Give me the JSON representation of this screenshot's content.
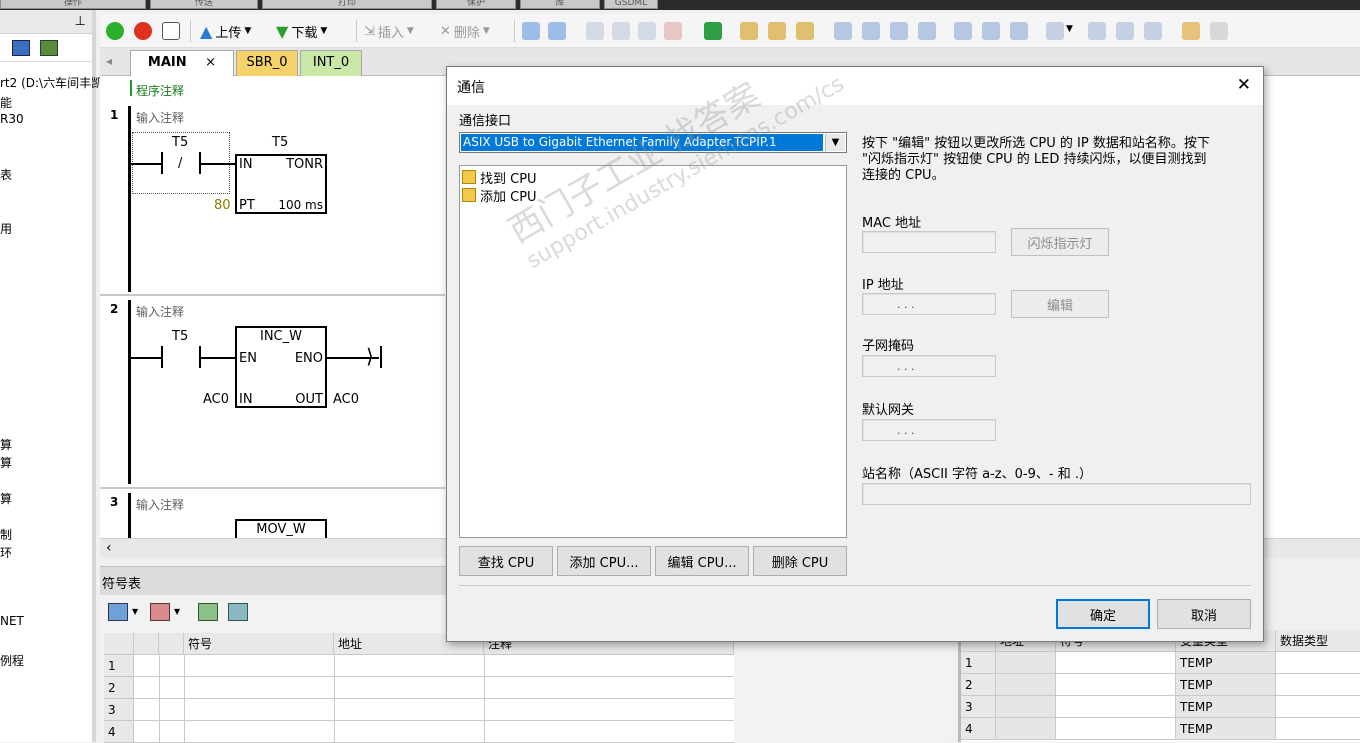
{
  "ribbon_tabs": [
    "操作",
    "传送",
    "打印",
    "保护",
    "库",
    "GSDML"
  ],
  "left_panel": {
    "items": [
      "rt2 (D:\\六车间丰凯",
      "能",
      "R30",
      "表",
      "用",
      "算",
      "算",
      "算",
      "制",
      "环",
      "NET",
      "例程"
    ]
  },
  "toolbar": {
    "upload_label": "上传",
    "download_label": "下载",
    "insert_label": "插入",
    "delete_label": "删除"
  },
  "tabs": [
    {
      "label": "MAIN",
      "close": "×"
    },
    {
      "label": "SBR_0"
    },
    {
      "label": "INT_0"
    }
  ],
  "editor": {
    "program_comment": "程序注释",
    "rungs": [
      {
        "num": "1",
        "comment": "输入注释"
      },
      {
        "num": "2",
        "comment": "输入注释"
      },
      {
        "num": "3",
        "comment": "输入注释"
      }
    ],
    "rung1": {
      "contact_label": "T5",
      "contact_symbol": "/",
      "box_label": "T5",
      "box_in": "IN",
      "box_type": "TONR",
      "pt_value": "80",
      "box_pt": "PT",
      "box_time": "100 ms"
    },
    "rung2": {
      "contact_label": "T5",
      "box_title": "INC_W",
      "box_en": "EN",
      "box_eno": "ENO",
      "in_value": "AC0",
      "box_in": "IN",
      "box_out": "OUT",
      "out_value": "AC0"
    },
    "rung3": {
      "box_title": "MOV_W"
    }
  },
  "symbol_table": {
    "title": "符号表",
    "headers": [
      "符号",
      "地址",
      "注释"
    ],
    "rows": [
      "1",
      "2",
      "3",
      "4"
    ]
  },
  "var_table": {
    "headers": [
      "地址",
      "符号",
      "变量类型",
      "数据类型"
    ],
    "rows": [
      {
        "num": "1",
        "type": "TEMP"
      },
      {
        "num": "2",
        "type": "TEMP"
      },
      {
        "num": "3",
        "type": "TEMP"
      },
      {
        "num": "4",
        "type": "TEMP"
      }
    ]
  },
  "dialog": {
    "title": "通信",
    "close": "✕",
    "interface_label": "通信接口",
    "interface_value": "ASIX USB to Gigabit Ethernet Family Adapter.TCPIP.1",
    "cpu_list": [
      {
        "label": "找到 CPU"
      },
      {
        "label": "添加 CPU"
      }
    ],
    "info_text_1": "按下 \"编辑\" 按钮以更改所选 CPU 的 IP 数据和站名称。按下",
    "info_text_2": "\"闪烁指示灯\" 按钮使 CPU 的 LED 持续闪烁，以便目测找到",
    "info_text_3": "连接的 CPU。",
    "mac_label": "MAC 地址",
    "blink_button": "闪烁指示灯",
    "ip_label": "IP 地址",
    "edit_button": "编辑",
    "subnet_label": "子网掩码",
    "gateway_label": "默认网关",
    "station_label": "站名称（ASCII 字符 a-z、0-9、- 和 .）",
    "ip_dots": ".     .     .",
    "find_cpu_button": "查找 CPU",
    "add_cpu_button": "添加 CPU...",
    "edit_cpu_button": "编辑 CPU...",
    "delete_cpu_button": "删除 CPU",
    "ok_button": "确定",
    "cancel_button": "取消"
  },
  "watermark": {
    "line1": "西门子工业  找答案",
    "line2": "support.industry.siemens.com/cs"
  }
}
